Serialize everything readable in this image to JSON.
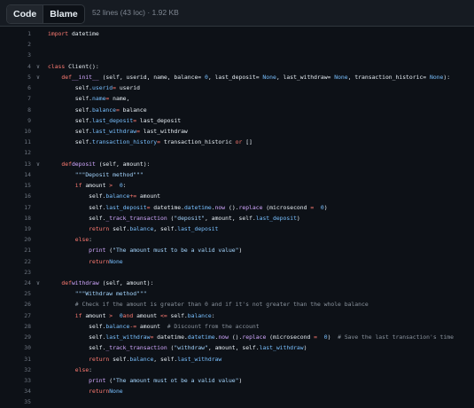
{
  "toolbar": {
    "code_label": "Code",
    "blame_label": "Blame",
    "file_info": "52 lines (43 loc) · 1.92 KB"
  },
  "lines": [
    {
      "n": "1",
      "fold": false,
      "t": [
        [
          "kw",
          "import"
        ],
        [
          "",
          "datetime"
        ]
      ]
    },
    {
      "n": "2",
      "fold": false,
      "t": []
    },
    {
      "n": "3",
      "fold": false,
      "t": []
    },
    {
      "n": "4",
      "fold": true,
      "t": [
        [
          "kw",
          "class"
        ],
        [
          "",
          "Client():"
        ]
      ]
    },
    {
      "n": "5",
      "fold": true,
      "t": [
        [
          "",
          "    "
        ],
        [
          "kw",
          "def"
        ],
        [
          "",
          ""
        ],
        [
          "fn",
          "__init__"
        ],
        [
          "",
          "(self, userid, name, balance="
        ],
        [
          "num",
          "0"
        ],
        [
          "",
          ", last_deposit="
        ],
        [
          "num",
          "None"
        ],
        [
          "",
          ", last_withdraw="
        ],
        [
          "num",
          "None"
        ],
        [
          "",
          ", transaction_historic="
        ],
        [
          "num",
          "None"
        ],
        [
          "",
          "):"
        ]
      ]
    },
    {
      "n": "6",
      "fold": false,
      "t": [
        [
          "",
          "        self."
        ],
        [
          "num",
          "userid"
        ],
        [
          "",
          ""
        ],
        [
          "kw",
          "="
        ],
        [
          "",
          "userid"
        ]
      ]
    },
    {
      "n": "7",
      "fold": false,
      "t": [
        [
          "",
          "        self."
        ],
        [
          "num",
          "name"
        ],
        [
          "",
          ""
        ],
        [
          "kw",
          "="
        ],
        [
          "",
          "name,"
        ]
      ]
    },
    {
      "n": "8",
      "fold": false,
      "t": [
        [
          "",
          "        self."
        ],
        [
          "num",
          "balance"
        ],
        [
          "",
          ""
        ],
        [
          "kw",
          "="
        ],
        [
          "",
          "balance"
        ]
      ]
    },
    {
      "n": "9",
      "fold": false,
      "t": [
        [
          "",
          "        self."
        ],
        [
          "num",
          "last_deposit"
        ],
        [
          "",
          ""
        ],
        [
          "kw",
          "="
        ],
        [
          "",
          "last_deposit"
        ]
      ]
    },
    {
      "n": "10",
      "fold": false,
      "t": [
        [
          "",
          "        self."
        ],
        [
          "num",
          "last_withdraw"
        ],
        [
          "",
          ""
        ],
        [
          "kw",
          "="
        ],
        [
          "",
          "last_withdraw"
        ]
      ]
    },
    {
      "n": "11",
      "fold": false,
      "t": [
        [
          "",
          "        self."
        ],
        [
          "num",
          "transaction_history"
        ],
        [
          "",
          ""
        ],
        [
          "kw",
          "="
        ],
        [
          "",
          "transaction_historic"
        ],
        [
          "kw",
          "or"
        ],
        [
          "",
          "[]"
        ]
      ]
    },
    {
      "n": "12",
      "fold": false,
      "t": []
    },
    {
      "n": "13",
      "fold": true,
      "t": [
        [
          "",
          "    "
        ],
        [
          "kw",
          "def"
        ],
        [
          "",
          ""
        ],
        [
          "fn",
          "deposit"
        ],
        [
          "",
          "(self, amount):"
        ]
      ]
    },
    {
      "n": "14",
      "fold": false,
      "t": [
        [
          "",
          "        "
        ],
        [
          "str",
          "\"\"\"Deposit method\"\"\""
        ]
      ]
    },
    {
      "n": "15",
      "fold": false,
      "t": [
        [
          "",
          "        "
        ],
        [
          "kw",
          "if"
        ],
        [
          "",
          "amount"
        ],
        [
          "kw",
          ">"
        ],
        [
          "num",
          "0"
        ],
        [
          "",
          ":"
        ]
      ]
    },
    {
      "n": "16",
      "fold": false,
      "t": [
        [
          "",
          "            self."
        ],
        [
          "num",
          "balance"
        ],
        [
          "",
          ""
        ],
        [
          "kw",
          "+="
        ],
        [
          "",
          "amount"
        ]
      ]
    },
    {
      "n": "17",
      "fold": false,
      "t": [
        [
          "",
          "            self."
        ],
        [
          "num",
          "last_deposit"
        ],
        [
          "",
          ""
        ],
        [
          "kw",
          "="
        ],
        [
          "",
          "datetime."
        ],
        [
          "num",
          "datetime"
        ],
        [
          "",
          "."
        ],
        [
          "fn",
          "now"
        ],
        [
          "",
          "()."
        ],
        [
          "fn",
          "replace"
        ],
        [
          "",
          "(microsecond"
        ],
        [
          "kw",
          "="
        ],
        [
          "num",
          "0"
        ],
        [
          "",
          ")"
        ]
      ]
    },
    {
      "n": "18",
      "fold": false,
      "t": [
        [
          "",
          "            self."
        ],
        [
          "fn",
          "_track_transaction"
        ],
        [
          "",
          "("
        ],
        [
          "str",
          "\"deposit\""
        ],
        [
          "",
          ", amount, self."
        ],
        [
          "num",
          "last_deposit"
        ],
        [
          "",
          ")"
        ]
      ]
    },
    {
      "n": "19",
      "fold": false,
      "t": [
        [
          "",
          "            "
        ],
        [
          "kw",
          "return"
        ],
        [
          "",
          "self."
        ],
        [
          "num",
          "balance"
        ],
        [
          "",
          ", self."
        ],
        [
          "num",
          "last_deposit"
        ]
      ]
    },
    {
      "n": "20",
      "fold": false,
      "t": [
        [
          "",
          "        "
        ],
        [
          "kw",
          "else"
        ],
        [
          "",
          ":"
        ]
      ]
    },
    {
      "n": "21",
      "fold": false,
      "t": [
        [
          "",
          "            "
        ],
        [
          "fn",
          "print"
        ],
        [
          "",
          "("
        ],
        [
          "str",
          "\"The amount must to be a valid value\""
        ],
        [
          "",
          ")"
        ]
      ]
    },
    {
      "n": "22",
      "fold": false,
      "t": [
        [
          "",
          "            "
        ],
        [
          "kw",
          "return"
        ],
        [
          "",
          ""
        ],
        [
          "num",
          "None"
        ]
      ]
    },
    {
      "n": "23",
      "fold": false,
      "t": []
    },
    {
      "n": "24",
      "fold": true,
      "t": [
        [
          "",
          "    "
        ],
        [
          "kw",
          "def"
        ],
        [
          "",
          ""
        ],
        [
          "fn",
          "withdraw"
        ],
        [
          "",
          "(self, amount):"
        ]
      ]
    },
    {
      "n": "25",
      "fold": false,
      "t": [
        [
          "",
          "        "
        ],
        [
          "str",
          "\"\"\"Withdraw method\"\"\""
        ]
      ]
    },
    {
      "n": "26",
      "fold": false,
      "t": [
        [
          "",
          "        "
        ],
        [
          "com",
          "# Check if the amount is greater than 0 and if it's not greater than the whole balance"
        ]
      ]
    },
    {
      "n": "27",
      "fold": false,
      "t": [
        [
          "",
          "        "
        ],
        [
          "kw",
          "if"
        ],
        [
          "",
          "amount"
        ],
        [
          "kw",
          ">"
        ],
        [
          "num",
          "0"
        ],
        [
          "",
          ""
        ],
        [
          "kw",
          "and"
        ],
        [
          "",
          "amount"
        ],
        [
          "kw",
          "<="
        ],
        [
          "",
          "self."
        ],
        [
          "num",
          "balance"
        ],
        [
          "",
          ":"
        ]
      ]
    },
    {
      "n": "28",
      "fold": false,
      "t": [
        [
          "",
          "            self."
        ],
        [
          "num",
          "balance"
        ],
        [
          "",
          ""
        ],
        [
          "kw",
          "-="
        ],
        [
          "",
          "amount  "
        ],
        [
          "com",
          "# Discount from the account"
        ]
      ]
    },
    {
      "n": "29",
      "fold": false,
      "t": [
        [
          "",
          "            self."
        ],
        [
          "num",
          "last_withdraw"
        ],
        [
          "",
          ""
        ],
        [
          "kw",
          "="
        ],
        [
          "",
          "datetime."
        ],
        [
          "num",
          "datetime"
        ],
        [
          "",
          "."
        ],
        [
          "fn",
          "now"
        ],
        [
          "",
          "()."
        ],
        [
          "fn",
          "replace"
        ],
        [
          "",
          "(microsecond"
        ],
        [
          "kw",
          "="
        ],
        [
          "num",
          "0"
        ],
        [
          "",
          ")  "
        ],
        [
          "com",
          "# Save the last transaction's time"
        ]
      ]
    },
    {
      "n": "30",
      "fold": false,
      "t": [
        [
          "",
          "            self."
        ],
        [
          "fn",
          "_track_transaction"
        ],
        [
          "",
          "("
        ],
        [
          "str",
          "\"withdraw\""
        ],
        [
          "",
          ", amount, self."
        ],
        [
          "num",
          "last_withdraw"
        ],
        [
          "",
          ")"
        ]
      ]
    },
    {
      "n": "31",
      "fold": false,
      "t": [
        [
          "",
          "            "
        ],
        [
          "kw",
          "return"
        ],
        [
          "",
          "self."
        ],
        [
          "num",
          "balance"
        ],
        [
          "",
          ", self."
        ],
        [
          "num",
          "last_withdraw"
        ]
      ]
    },
    {
      "n": "32",
      "fold": false,
      "t": [
        [
          "",
          "        "
        ],
        [
          "kw",
          "else"
        ],
        [
          "",
          ":"
        ]
      ]
    },
    {
      "n": "33",
      "fold": false,
      "t": [
        [
          "",
          "            "
        ],
        [
          "fn",
          "print"
        ],
        [
          "",
          "("
        ],
        [
          "str",
          "\"The amount must ot be a valid value\""
        ],
        [
          "",
          ")"
        ]
      ]
    },
    {
      "n": "34",
      "fold": false,
      "t": [
        [
          "",
          "            "
        ],
        [
          "kw",
          "return"
        ],
        [
          "",
          ""
        ],
        [
          "num",
          "None"
        ]
      ]
    },
    {
      "n": "35",
      "fold": false,
      "t": []
    }
  ]
}
